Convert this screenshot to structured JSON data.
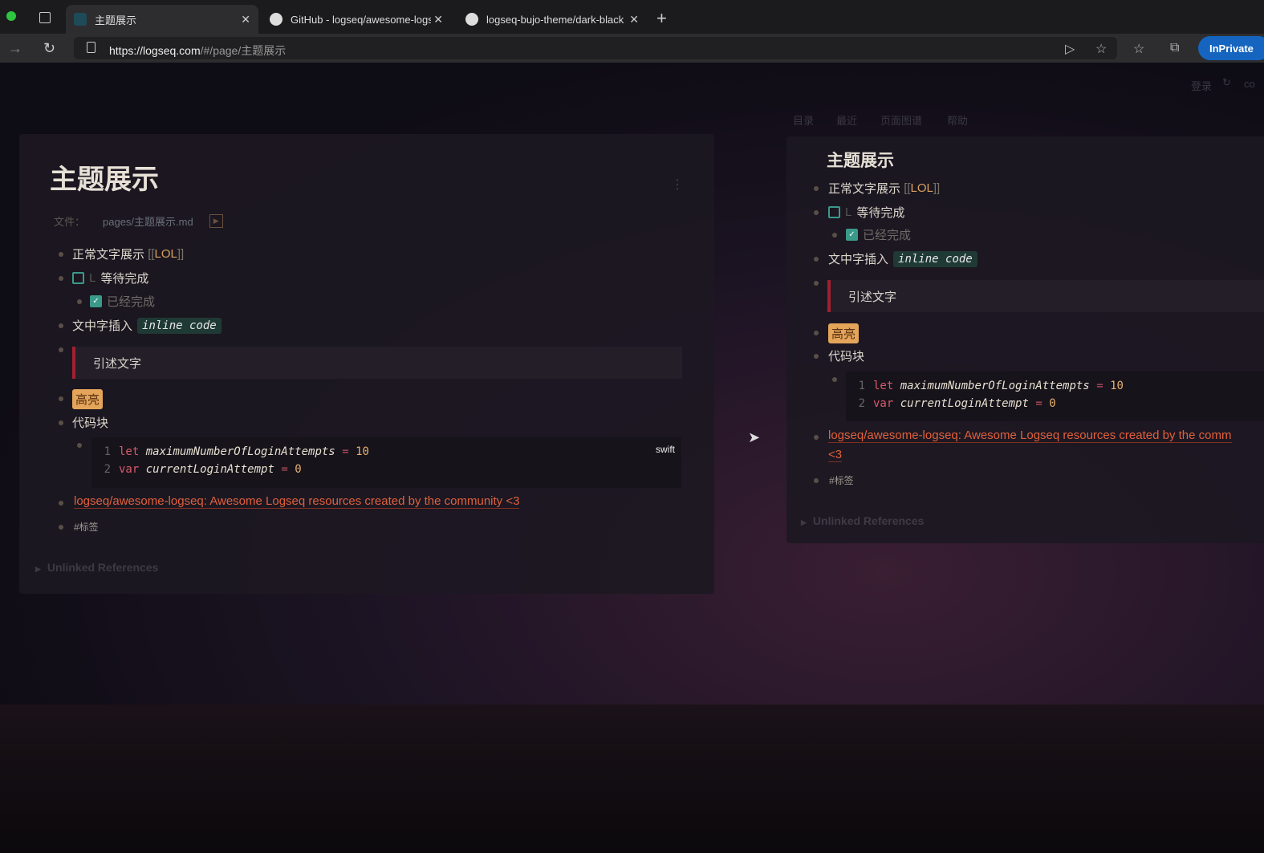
{
  "browser": {
    "tabs": [
      {
        "title": "主题展示",
        "icon": "logseq-icon",
        "active": true
      },
      {
        "title": "GitHub - logseq/awesome-logseq",
        "icon": "github-icon"
      },
      {
        "title": "logseq-bujo-theme/dark-black",
        "icon": "github-icon"
      }
    ],
    "url_host": "https://logseq.com",
    "url_path": "/#/page/主题展示",
    "inprivate": "InPrivate"
  },
  "header": {
    "login": "登录",
    "user": "co",
    "nav": [
      "目录",
      "最近",
      "页面图谱",
      "帮助"
    ]
  },
  "page": {
    "title": "主题展示",
    "file_label": "文件：",
    "file_path": "pages/主题展示.md",
    "normal_text": "正常文字展示",
    "ref_open": "[[",
    "ref_name": "LOL",
    "ref_close": "]]",
    "todo_marker": "L",
    "todo_text": "等待完成",
    "done_text": "已经完成",
    "inline_prefix": "文中字插入",
    "inline_code": "inline code",
    "quote": "引述文字",
    "highlight": "高亮",
    "code_label": "代码块",
    "code_lang": "swift",
    "code_lines": [
      {
        "n": "1",
        "kw": "let",
        "name": "maximumNumberOfLoginAttempts",
        "op": "=",
        "val": "10"
      },
      {
        "n": "2",
        "kw": "var",
        "name": "currentLoginAttempt",
        "op": "=",
        "val": "0"
      }
    ],
    "link": "logseq/awesome-logseq: Awesome Logseq resources created by the community <3",
    "link_r1": "logseq/awesome-logseq: Awesome Logseq resources created by the comm",
    "link_r2": "<3",
    "tag": "#标签",
    "unlinked": "Unlinked References"
  }
}
